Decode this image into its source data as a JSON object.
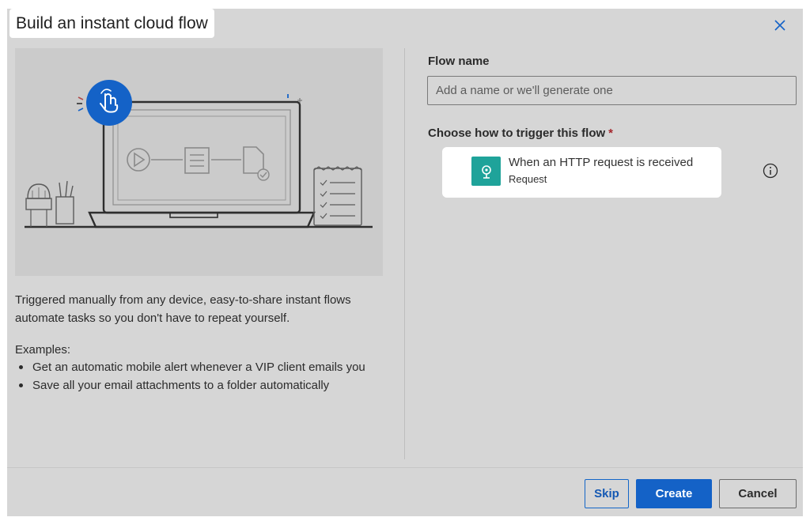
{
  "dialog": {
    "title": "Build an instant cloud flow",
    "close_icon": "close-icon"
  },
  "left": {
    "illustration_icon": "touch-hand-icon",
    "description": "Triggered manually from any device, easy-to-share instant flows automate tasks so you don't have to repeat yourself.",
    "examples_label": "Examples:",
    "examples": [
      "Get an automatic mobile alert whenever a VIP client emails you",
      "Save all your email attachments to a folder automatically"
    ]
  },
  "right": {
    "flow_name_label": "Flow name",
    "flow_name_placeholder": "Add a name or we'll generate one",
    "flow_name_value": "",
    "trigger_label": "Choose how to trigger this flow",
    "required_mark": "*",
    "trigger": {
      "title": "When an HTTP request is received",
      "subtitle": "Request",
      "icon": "http-request-icon",
      "icon_color": "#1fa39a"
    },
    "info_icon": "info-icon"
  },
  "footer": {
    "skip_label": "Skip",
    "create_label": "Create",
    "cancel_label": "Cancel"
  },
  "colors": {
    "accent": "#1462c7",
    "required": "#a4262c"
  }
}
